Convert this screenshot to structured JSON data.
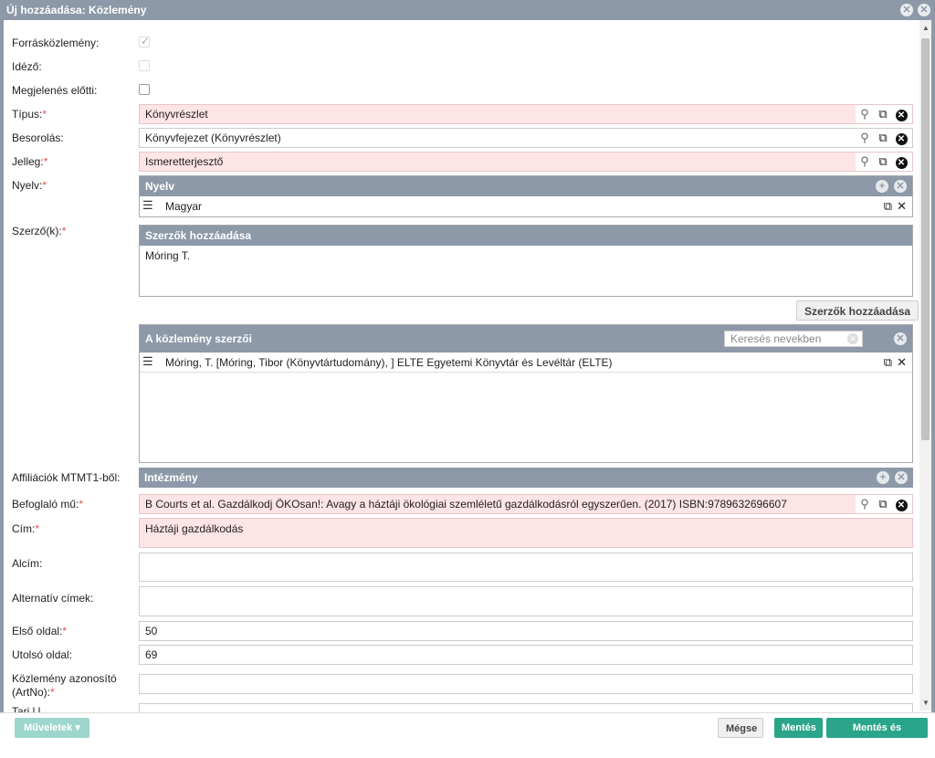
{
  "window": {
    "title": "Új hozzáadása: Közlemény"
  },
  "fields": {
    "forraskozlemeny": {
      "label": "Forrásközlemény:"
    },
    "idezo": {
      "label": "Idéző:"
    },
    "megjelenes_elotti": {
      "label": "Megjelenés előtti:"
    },
    "tipus": {
      "label": "Típus:",
      "value": "Könyvrészlet"
    },
    "besorolas": {
      "label": "Besorolás:",
      "value": "Könyvfejezet (Könyvrészlet)"
    },
    "jelleg": {
      "label": "Jelleg:",
      "value": "Ismeretterjesztő"
    },
    "nyelv": {
      "label": "Nyelv:",
      "panel_title": "Nyelv",
      "items": [
        "Magyar"
      ]
    },
    "szerzok": {
      "label": "Szerző(k):",
      "panel_title": "Szerzők hozzáadása",
      "textarea_value": "Móring T.",
      "add_button": "Szerzők hozzáadása"
    },
    "kozlemeny_szerzoi": {
      "panel_title": "A közlemény szerzői",
      "search_placeholder": "Keresés nevekben",
      "items": [
        "Móring, T. [Móring, Tibor (Könyvtártudomány), ] ELTE Egyetemi Könyvtár és Levéltár (ELTE)"
      ]
    },
    "affiliaciok": {
      "label": "Affiliációk MTMT1-ből:",
      "panel_title": "Intézmény"
    },
    "befoglalo_mu": {
      "label": "Befoglaló mű:",
      "value": "B Courts et al. Gazdálkodj ÖKOsan!: Avagy a háztáji ökológiai szemléletű gazdálkodásról egyszerűen. (2017) ISBN:9789632696607"
    },
    "cim": {
      "label": "Cím:",
      "value": "Háztáji gazdálkodás"
    },
    "alcim": {
      "label": "Alcím:",
      "value": ""
    },
    "alternativ_cimek": {
      "label": "Alternatív címek:",
      "value": ""
    },
    "elso_oldal": {
      "label": "Első oldal:",
      "value": "50"
    },
    "utolso_oldal": {
      "label": "Utolsó oldal:",
      "value": "69"
    },
    "artno": {
      "label_line1": "Közlemény azonosító",
      "label_line2": "(ArtNo):",
      "value": ""
    },
    "truncated": {
      "label": "Tari l l"
    }
  },
  "footer": {
    "muveletek": "Műveletek",
    "megse": "Mégse",
    "mentes": "Mentés",
    "mentes_bezaras": "Mentés és bezárás"
  },
  "colors": {
    "header": "#8d99a8",
    "required_bg": "#fde4e6",
    "primary": "#2aa58a"
  }
}
